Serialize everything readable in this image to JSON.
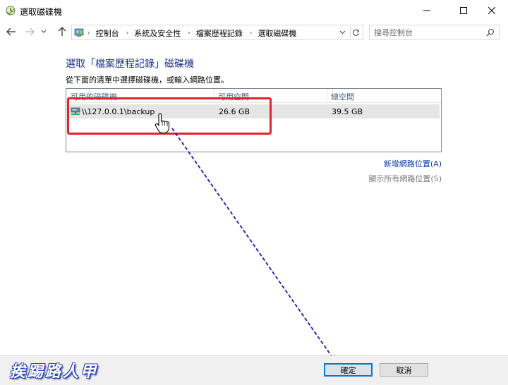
{
  "window": {
    "title": "選取磁碟機"
  },
  "address_bar": {
    "breadcrumbs": [
      "控制台",
      "系統及安全性",
      "檔案歷程記錄",
      "選取磁碟機"
    ]
  },
  "search": {
    "placeholder": "搜尋控制台"
  },
  "content": {
    "heading": "選取「檔案歷程記錄」磁碟機",
    "instruction": "從下面的清單中選擇磁碟機，或輸入網路位置。"
  },
  "drive_list": {
    "columns": [
      "可用的磁碟機",
      "可用空間",
      "總空間"
    ],
    "rows": [
      {
        "name": "\\\\127.0.0.1\\backup",
        "free": "26.6 GB",
        "total": "39.5 GB"
      }
    ]
  },
  "links": {
    "add_network": "新增網路位置(A)",
    "show_all": "顯示所有網路位置(S)"
  },
  "buttons": {
    "ok": "確定",
    "cancel": "取消"
  },
  "watermark": "挨踢路人甲",
  "colors": {
    "heading": "#1e3287",
    "highlight_box": "#e2242c",
    "annotation_arrow": "#1a1aa8",
    "link": "#0f3fae"
  },
  "icons": {
    "title": "file-history-icon",
    "back": "arrow-left-icon",
    "forward": "arrow-right-icon",
    "up": "arrow-up-icon",
    "refresh": "refresh-icon",
    "search": "magnifier-icon",
    "drive": "network-drive-icon"
  }
}
